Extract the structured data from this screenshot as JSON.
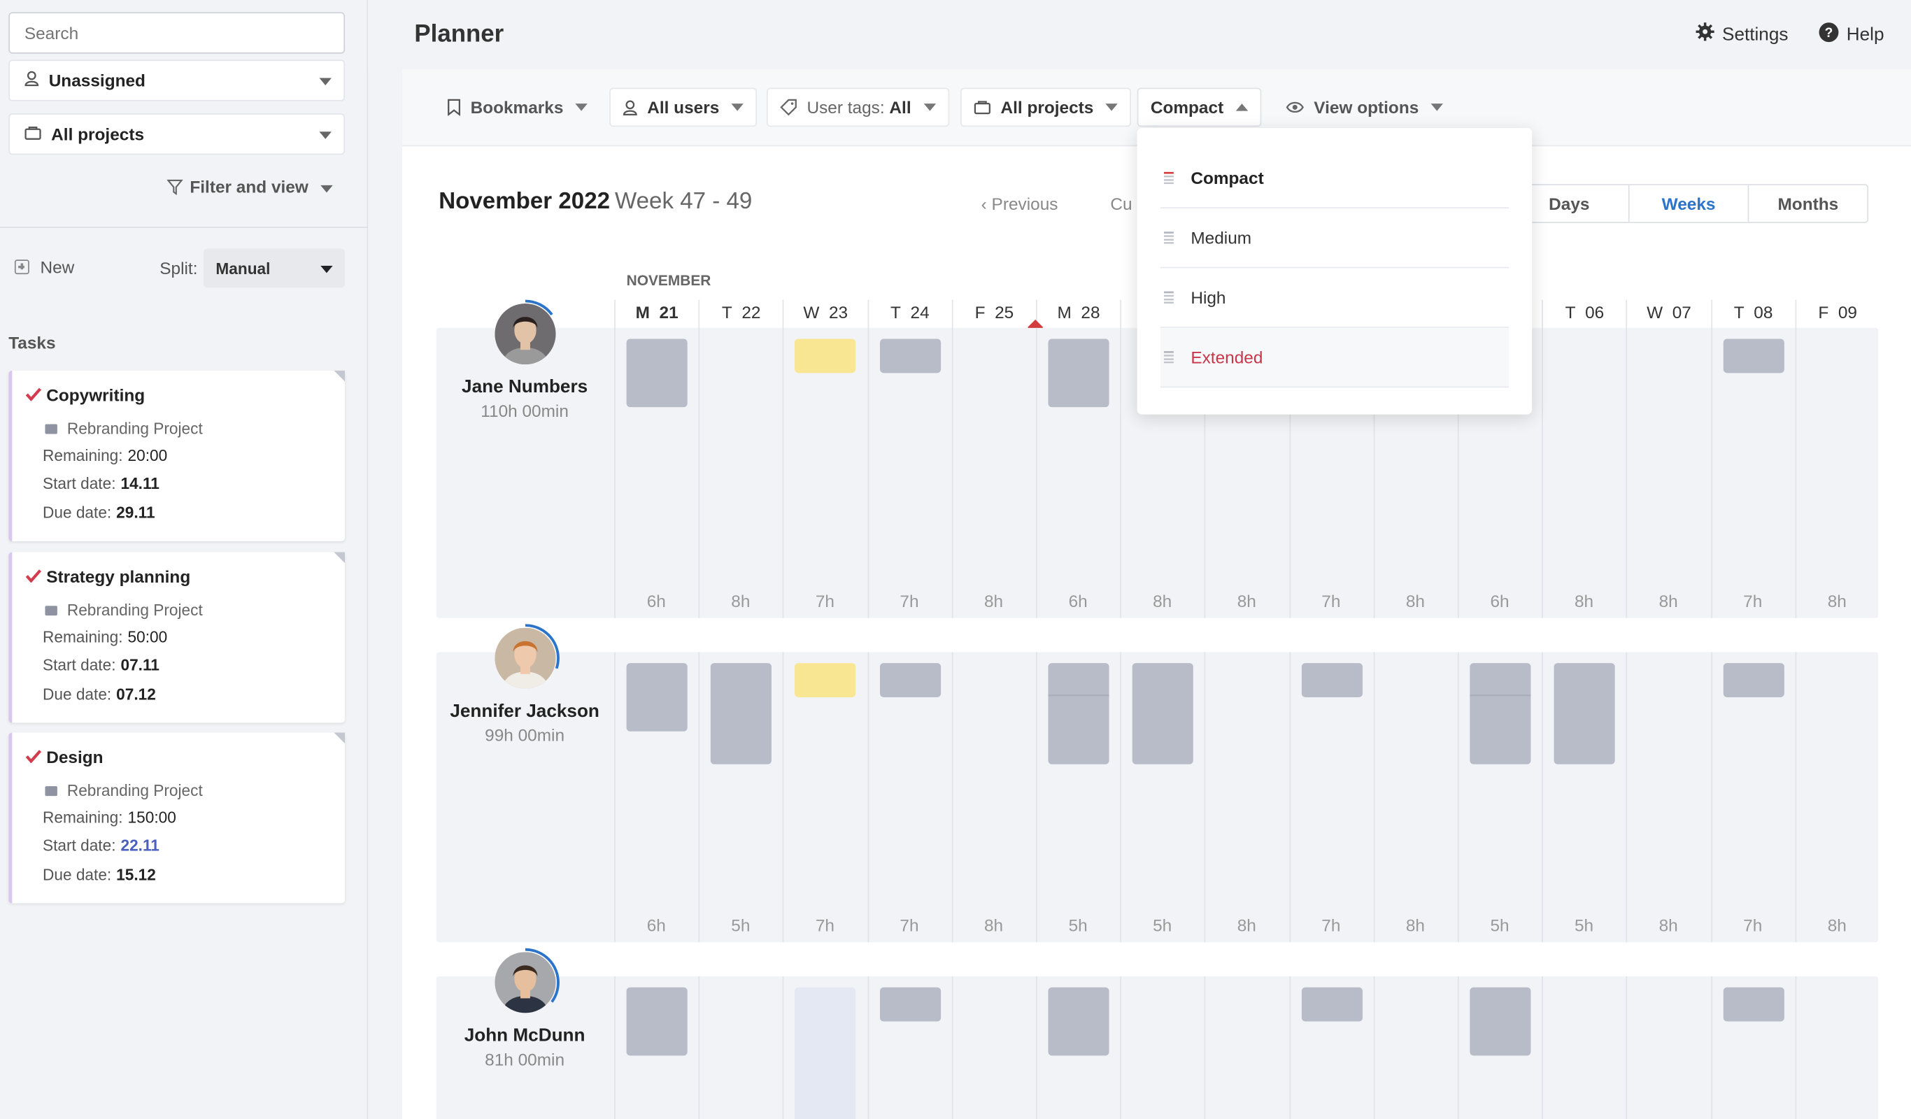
{
  "sidebar": {
    "search_placeholder": "Search",
    "assignee_select": "Unassigned",
    "projects_select": "All projects",
    "filter_view": "Filter and view",
    "new_label": "New",
    "split_label": "Split:",
    "split_value": "Manual",
    "tasks_heading": "Tasks",
    "tasks": [
      {
        "title": "Copywriting",
        "project": "Rebranding Project",
        "remaining_label": "Remaining:",
        "remaining": "20:00",
        "start_label": "Start date:",
        "start": "14.11",
        "due_label": "Due date:",
        "due": "29.11"
      },
      {
        "title": "Strategy planning",
        "project": "Rebranding Project",
        "remaining_label": "Remaining:",
        "remaining": "50:00",
        "start_label": "Start date:",
        "start": "07.11",
        "due_label": "Due date:",
        "due": "07.12"
      },
      {
        "title": "Design",
        "project": "Rebranding Project",
        "remaining_label": "Remaining:",
        "remaining": "150:00",
        "start_label": "Start date:",
        "start": "22.11",
        "due_label": "Due date:",
        "due": "15.12"
      }
    ]
  },
  "header": {
    "title": "Planner",
    "settings": "Settings",
    "help": "Help"
  },
  "toolbar": {
    "bookmarks": "Bookmarks",
    "all_users": "All users",
    "user_tags_label": "User tags:",
    "user_tags_value": "All",
    "all_projects": "All projects",
    "density": "Compact",
    "view_options": "View options"
  },
  "density_menu": {
    "items": [
      "Compact",
      "Medium",
      "High",
      "Extended"
    ],
    "selected": "Compact"
  },
  "calendar": {
    "month_year": "November 2022",
    "week_range": "Week 47 - 49",
    "previous": "Previous",
    "current_partial": "Cu",
    "range_options": [
      "Days",
      "Weeks",
      "Months"
    ],
    "range_selected": "Weeks",
    "month_label": "NOVEMBER",
    "days": [
      {
        "dow": "M",
        "num": "21"
      },
      {
        "dow": "T",
        "num": "22"
      },
      {
        "dow": "W",
        "num": "23"
      },
      {
        "dow": "T",
        "num": "24"
      },
      {
        "dow": "F",
        "num": "25"
      },
      {
        "dow": "M",
        "num": "28"
      },
      {
        "dow": "",
        "num": ""
      },
      {
        "dow": "",
        "num": ""
      },
      {
        "dow": "",
        "num": ""
      },
      {
        "dow": "",
        "num": ""
      },
      {
        "dow": "",
        "num": ""
      },
      {
        "dow": "T",
        "num": "06"
      },
      {
        "dow": "W",
        "num": "07"
      },
      {
        "dow": "T",
        "num": "08"
      },
      {
        "dow": "F",
        "num": "09"
      }
    ]
  },
  "users": [
    {
      "name": "Jane Numbers",
      "hours": "110h 00min",
      "progress": 0.15,
      "day_hours": [
        "6h",
        "8h",
        "7h",
        "7h",
        "8h",
        "6h",
        "8h",
        "8h",
        "7h",
        "8h",
        "6h",
        "8h",
        "8h",
        "7h",
        "8h"
      ]
    },
    {
      "name": "Jennifer Jackson",
      "hours": "99h 00min",
      "progress": 0.3,
      "day_hours": [
        "6h",
        "5h",
        "7h",
        "7h",
        "8h",
        "5h",
        "5h",
        "8h",
        "7h",
        "8h",
        "5h",
        "5h",
        "8h",
        "7h",
        "8h"
      ]
    },
    {
      "name": "John McDunn",
      "hours": "81h 00min",
      "progress": 0.35,
      "day_hours": []
    }
  ],
  "colors": {
    "accent_blue": "#2b74c9",
    "today_marker": "#d33c3c",
    "block_gray": "#b7bcc8",
    "block_yellow": "#f8e693",
    "extended_red": "#c9364a"
  }
}
